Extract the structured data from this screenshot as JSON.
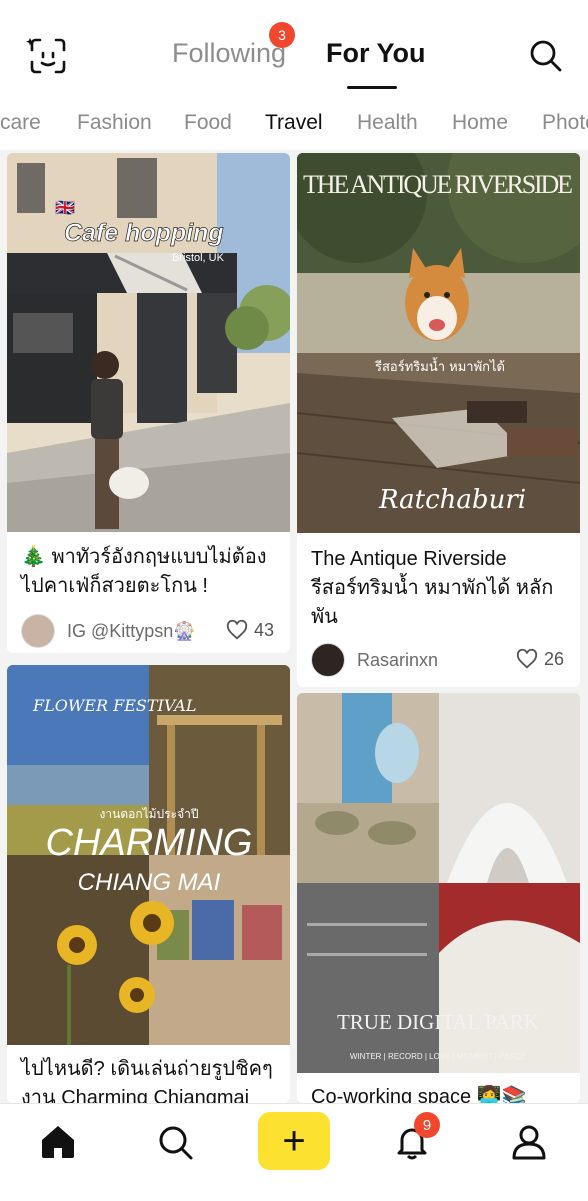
{
  "header": {
    "tabs": [
      {
        "label": "Following",
        "badge": "3"
      },
      {
        "label": "For You"
      }
    ],
    "active_tab": "For You",
    "left_icon": "ai-face-scan-icon",
    "right_icon": "search-icon"
  },
  "categories": [
    "care",
    "Fashion",
    "Food",
    "Travel",
    "Health",
    "Home",
    "Photo"
  ],
  "active_category": "Travel",
  "cards": [
    {
      "image_texts": {
        "main": "Cafe hopping",
        "sub": "Bristol, UK",
        "flag": "🇬🇧"
      },
      "title": "🎄 พาทัวร์อังกฤษแบบไม่ต้อง ไปคาเฟ่ก็สวยตะโกน !",
      "author": "IG @Kittypsn🎡",
      "likes": "43"
    },
    {
      "image_texts": {
        "main": "THE ANTIQUE RIVERSIDE",
        "sub": "รีสอร์ทริมน้ำ หมาพักได้",
        "script": "Ratchaburi"
      },
      "title": "The Antique Riverside รีสอร์ทริมน้ำ หมาพักได้ หลักพัน",
      "author": "Rasarinxn",
      "likes": "26"
    },
    {
      "image_texts": {
        "top": "FLOWER FESTIVAL",
        "small": "งานดอกไม้ประจำปี",
        "main": "CHARMING",
        "sub": "CHIANG MAI"
      },
      "title": "ไปไหนดี? เดินเล่นถ่ายรูปชิคๆ งาน Charming Chiangmai"
    },
    {
      "image_texts": {
        "main": "TRUE DIGITAL PARK",
        "tags": "WINTER  |  RECORD  |  LOVE  |  MOMENT  |  PEACE"
      },
      "title": "Co-working space 👩‍💻📚"
    }
  ],
  "bottom_nav": {
    "items": [
      "home-icon",
      "search-icon",
      "add-icon",
      "bell-icon",
      "profile-icon"
    ],
    "add_label": "+",
    "notification_badge": "9"
  },
  "colors": {
    "accent_yellow": "#fde131",
    "badge_red": "#f0472d"
  }
}
